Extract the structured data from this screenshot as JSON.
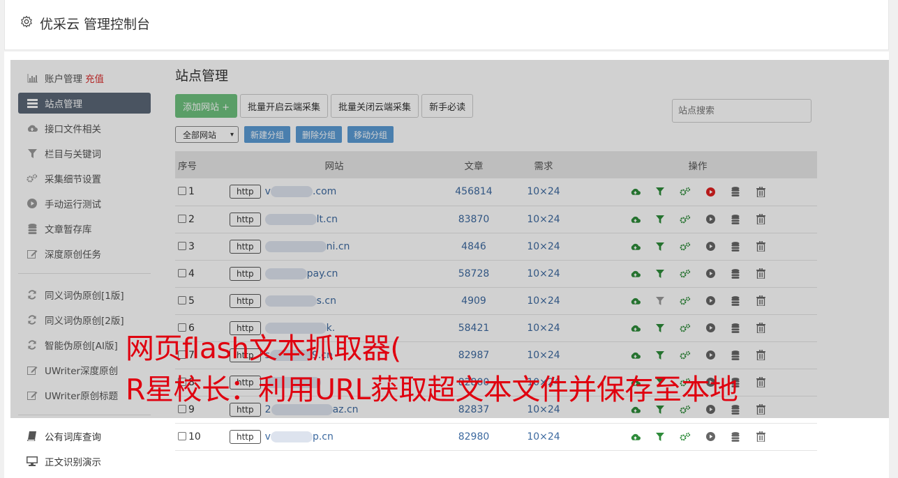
{
  "header": {
    "title": "优采云 管理控制台"
  },
  "sidebar": {
    "items": [
      {
        "label": "账户管理",
        "extra": "充值",
        "icon": "bar-chart-icon"
      },
      {
        "label": "站点管理",
        "icon": "server-icon",
        "active": true
      },
      {
        "label": "接口文件相关",
        "icon": "cloud-upload-icon"
      },
      {
        "label": "栏目与关键词",
        "icon": "filter-icon"
      },
      {
        "label": "采集细节设置",
        "icon": "cogs-icon"
      },
      {
        "label": "手动运行测试",
        "icon": "play-icon"
      },
      {
        "label": "文章暂存库",
        "icon": "database-icon"
      },
      {
        "label": "深度原创任务",
        "icon": "edit-icon"
      }
    ],
    "items2": [
      {
        "label": "同义词伪原创[1版]",
        "icon": "refresh-icon"
      },
      {
        "label": "同义词伪原创[2版]",
        "icon": "refresh-icon"
      },
      {
        "label": "智能伪原创[AI版]",
        "icon": "refresh-icon"
      },
      {
        "label": "UWriter深度原创",
        "icon": "edit-icon"
      },
      {
        "label": "UWriter原创标题",
        "icon": "edit-icon"
      }
    ],
    "items3": [
      {
        "label": "公有词库查询",
        "icon": "book-icon"
      },
      {
        "label": "正文识别演示",
        "icon": "monitor-icon"
      }
    ]
  },
  "main": {
    "title": "站点管理",
    "add_site": "添加网站 +",
    "batch_open": "批量开启云端采集",
    "batch_close": "批量关闭云端采集",
    "newbie": "新手必读",
    "search_placeholder": "站点搜索",
    "group_select": "全部网站",
    "new_group": "新建分组",
    "del_group": "删除分组",
    "move_group": "移动分组"
  },
  "table": {
    "headers": [
      "序号",
      "网站",
      "文章",
      "需求",
      "操作"
    ],
    "http_label": "http",
    "rows": [
      {
        "num": "1",
        "site_prefix": "v",
        "site_suffix": ".com",
        "articles": "456814",
        "need": "10×24",
        "running": true
      },
      {
        "num": "2",
        "site_prefix": "",
        "site_suffix": "lt.cn",
        "articles": "83870",
        "need": "10×24",
        "running": false
      },
      {
        "num": "3",
        "site_prefix": "",
        "site_suffix": "ni.cn",
        "articles": "4846",
        "need": "10×24",
        "running": false
      },
      {
        "num": "4",
        "site_prefix": "",
        "site_suffix": "pay.cn",
        "articles": "58728",
        "need": "10×24",
        "running": false
      },
      {
        "num": "5",
        "site_prefix": "",
        "site_suffix": "s.cn",
        "articles": "4909",
        "need": "10×24",
        "running": false,
        "filter_gray": true
      },
      {
        "num": "6",
        "site_prefix": "",
        "site_suffix": "k.",
        "articles": "58421",
        "need": "10×24",
        "running": false
      },
      {
        "num": "7",
        "site_prefix": "s",
        "site_suffix": "9.cn",
        "articles": "82987",
        "need": "10×24",
        "running": false
      },
      {
        "num": "8",
        "site_prefix": "",
        "site_suffix": "",
        "articles": "82800",
        "need": "10×24",
        "running": false
      },
      {
        "num": "9",
        "site_prefix": "2",
        "site_suffix": "az.cn",
        "articles": "82837",
        "need": "10×24",
        "running": false
      },
      {
        "num": "10",
        "site_prefix": "v",
        "site_suffix": "p.cn",
        "articles": "82980",
        "need": "10×24",
        "running": false
      }
    ]
  },
  "watermark": {
    "line1": "网页flash文本抓取器(",
    "line2": "R星校长：利用URL获取超文本文件并保存至本地"
  },
  "colors": {
    "green": "#2e8b3a",
    "red": "#e02020",
    "accent": "#5b9bd5",
    "sidebar_active": "#5b6777"
  }
}
